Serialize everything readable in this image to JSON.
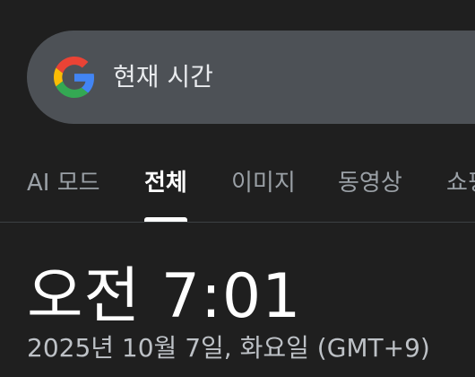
{
  "search": {
    "query": "현재 시간",
    "logo_icon": "google-g-icon"
  },
  "tabs": [
    {
      "label": "AI 모드",
      "active": false
    },
    {
      "label": "전체",
      "active": true
    },
    {
      "label": "이미지",
      "active": false
    },
    {
      "label": "동영상",
      "active": false
    },
    {
      "label": "쇼핑",
      "active": false
    }
  ],
  "result": {
    "time": "오전 7:01",
    "date": "2025년 10월 7일, 화요일 (GMT+9)"
  },
  "colors": {
    "background": "#1f1f1f",
    "searchbar": "#4d5156",
    "active_tab": "#ffffff",
    "inactive_tab": "#9aa0a6"
  }
}
